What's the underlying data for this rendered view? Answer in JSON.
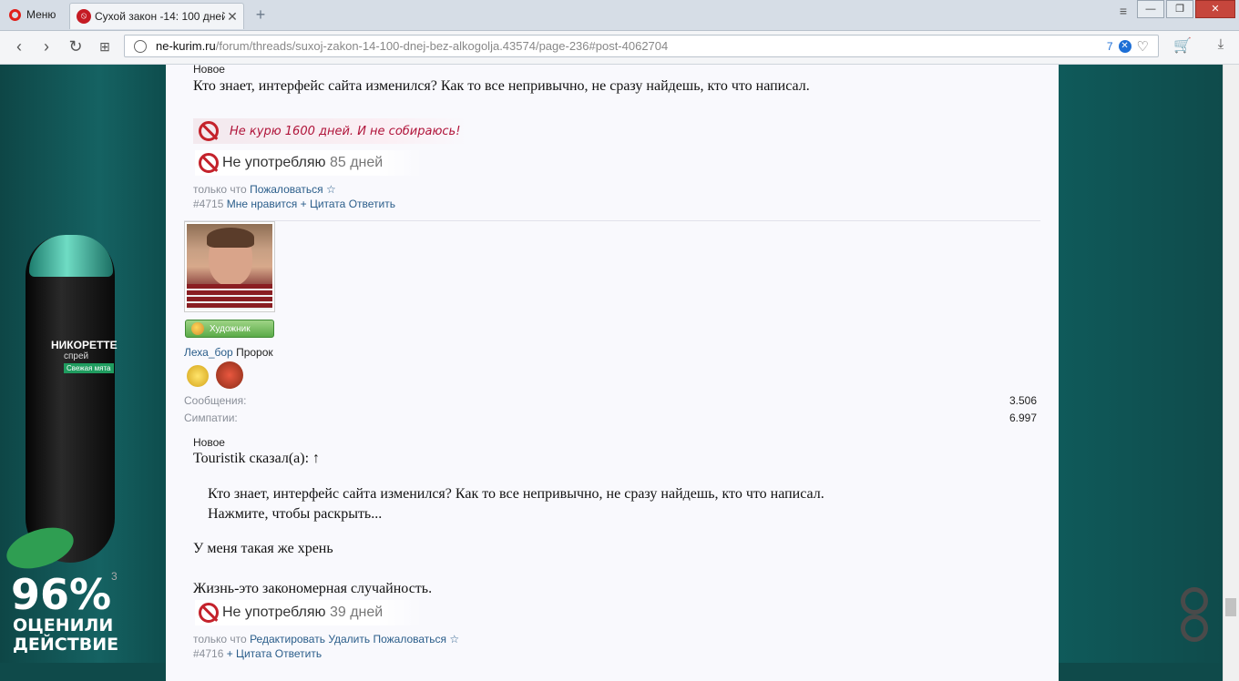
{
  "browser": {
    "menu_label": "Меню",
    "tab_title": "Сухой закон -14: 100 дней",
    "url_domain": "ne-kurim.ru",
    "url_path": "/forum/threads/suxoj-zakon-14-100-dnej-bez-alkogolja.43574/page-236#post-4062704",
    "shield_count": "7"
  },
  "ad": {
    "brand": "НИКОРЕТТЕ",
    "brand_sub": "спрей",
    "brand_tag": "Свежая мята",
    "big_percent": "96%",
    "line1": "ОЦЕНИЛИ",
    "line2": "ДЕЙСТВИЕ",
    "superscript": "3"
  },
  "post1": {
    "new_label": "Новое",
    "text": "Кто знает, интерфейс сайта изменился? Как то все непривычно, не сразу найдешь, кто что написал.",
    "banner_text": "Не курю 1600 дней. И не собираюсь!",
    "counter_label": "Не употребляю",
    "counter_days": "85 дней",
    "time": "только что",
    "complain": "Пожаловаться",
    "star": "☆",
    "number": "#4715",
    "like": "Мне нравится",
    "quote": "+ Цитата",
    "reply": "Ответить"
  },
  "post2": {
    "role": "Художник",
    "username": "Леха_бор",
    "title": "Пророк",
    "messages_label": "Сообщения:",
    "messages_value": "3.506",
    "likes_label": "Симпатии:",
    "likes_value": "6.997",
    "new_label": "Новое",
    "quote_author": "Touristik сказал(а): ↑",
    "quote_text": "Кто знает, интерфейс сайта изменился? Как то все непривычно, не сразу найдешь, кто что написал.",
    "expand": "Нажмите, чтобы раскрыть...",
    "text": "У меня такая же хрень",
    "signature": "Жизнь-это закономерная случайность.",
    "counter_label": "Не употребляю",
    "counter_days": "39 дней",
    "time": "только что",
    "edit": "Редактировать",
    "delete": "Удалить",
    "complain": "Пожаловаться",
    "star": "☆",
    "number": "#4716",
    "quote": "+ Цитата",
    "reply": "Ответить"
  }
}
